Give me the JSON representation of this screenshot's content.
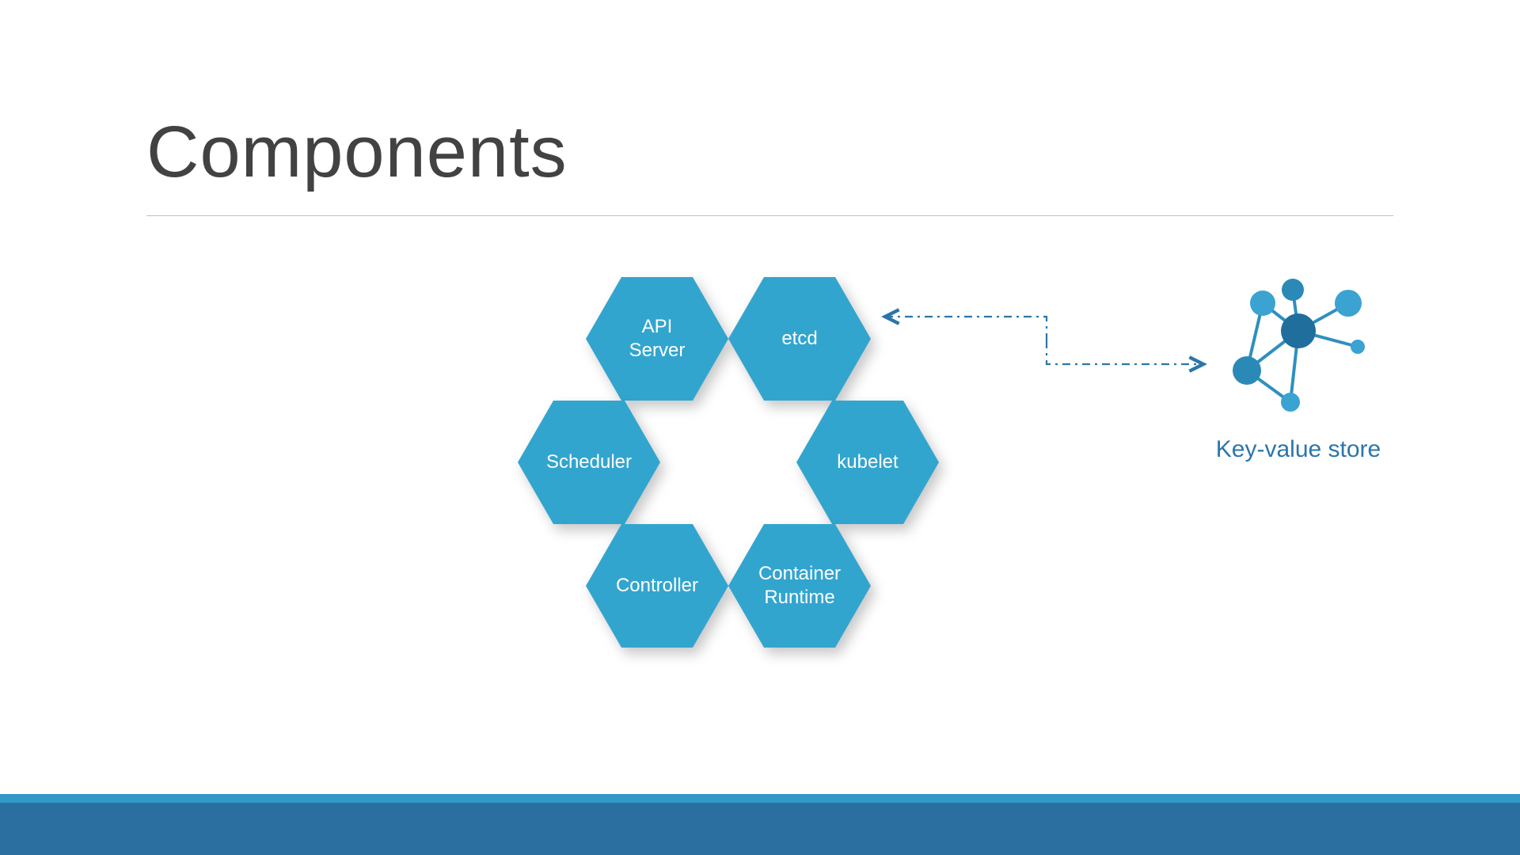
{
  "title": "Components",
  "hexagons": {
    "api": "API\nServer",
    "etcd": "etcd",
    "scheduler": "Scheduler",
    "kubelet": "kubelet",
    "controller": "Controller",
    "runtime": "Container\nRuntime"
  },
  "kv_store_label": "Key-value store",
  "colors": {
    "hex_fill": "#32a5cf",
    "accent": "#2b76a9",
    "footer_top": "#3398c6",
    "footer_bottom": "#2b6fa0"
  }
}
